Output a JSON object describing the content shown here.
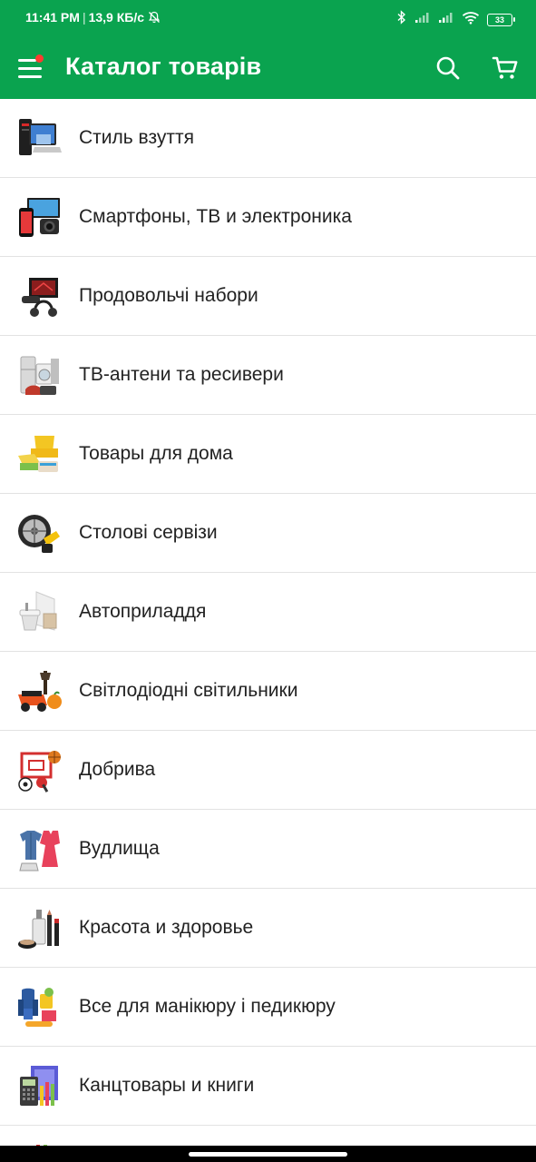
{
  "status_bar": {
    "time": "11:41 PM",
    "speed": "13,9 КБ/с",
    "battery": "33",
    "icons": [
      "bell-off-icon",
      "bluetooth-icon",
      "signal-icon",
      "signal-icon",
      "wifi-icon",
      "battery-icon"
    ]
  },
  "app_bar": {
    "title": "Каталог товарів",
    "menu_icon": "menu-icon",
    "search_icon": "search-icon",
    "cart_icon": "cart-icon",
    "accent": "#0aa34f",
    "badge_color": "#ff3b30"
  },
  "categories": [
    {
      "label": "Стиль взуття",
      "icon": "computers-icon"
    },
    {
      "label": "Смартфоны, ТВ и электроника",
      "icon": "smartphones-tv-icon"
    },
    {
      "label": "Продовольчі набори",
      "icon": "gaming-icon"
    },
    {
      "label": "ТВ-антени та ресивери",
      "icon": "appliances-icon"
    },
    {
      "label": "Товары для дома",
      "icon": "home-goods-icon"
    },
    {
      "label": "Столові сервізи",
      "icon": "auto-tools-icon"
    },
    {
      "label": "Автоприладдя",
      "icon": "plumbing-icon"
    },
    {
      "label": "Світлодіодні світильники",
      "icon": "garden-icon"
    },
    {
      "label": "Добрива",
      "icon": "sports-icon"
    },
    {
      "label": "Вудлища",
      "icon": "clothing-icon"
    },
    {
      "label": "Красота и здоровье",
      "icon": "beauty-icon"
    },
    {
      "label": "Все для манікюру і педикюру",
      "icon": "kids-icon"
    },
    {
      "label": "Канцтовары и книги",
      "icon": "stationery-icon"
    }
  ]
}
